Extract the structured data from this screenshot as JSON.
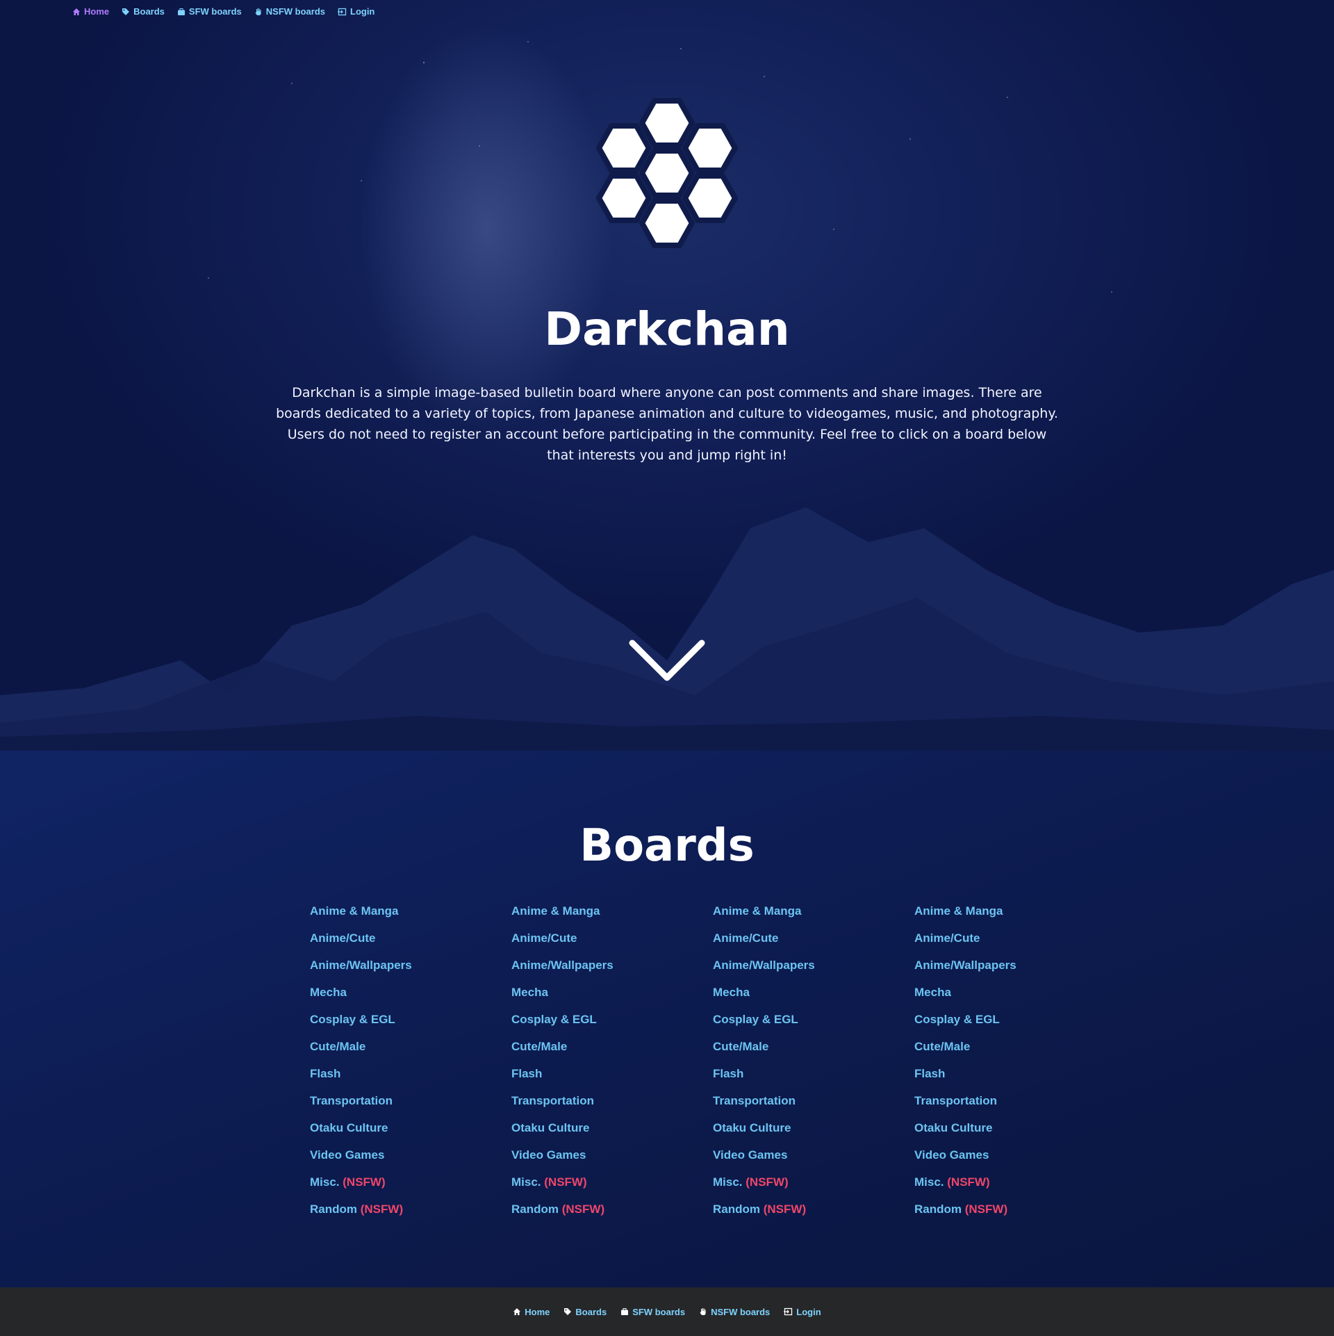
{
  "nav": {
    "items": [
      {
        "label": "Home",
        "icon": "home-icon",
        "active": true
      },
      {
        "label": "Boards",
        "icon": "tag-icon"
      },
      {
        "label": "SFW boards",
        "icon": "briefcase-icon"
      },
      {
        "label": "NSFW boards",
        "icon": "hand-icon"
      },
      {
        "label": "Login",
        "icon": "login-icon"
      }
    ]
  },
  "hero": {
    "title": "Darkchan",
    "intro": "Darkchan is a simple image-based bulletin board where anyone can post comments and share images. There are boards dedicated to a variety of topics, from Japanese animation and culture to videogames, music, and photography. Users do not need to register an account before participating in the community. Feel free to click on a board below that interests you and jump right in!"
  },
  "boards": {
    "title": "Boards",
    "nsfw_label": "(NSFW)",
    "columns": [
      [
        {
          "name": "Anime & Manga"
        },
        {
          "name": "Anime/Cute"
        },
        {
          "name": "Anime/Wallpapers"
        },
        {
          "name": "Mecha"
        },
        {
          "name": "Cosplay & EGL"
        },
        {
          "name": "Cute/Male"
        },
        {
          "name": "Flash"
        },
        {
          "name": "Transportation"
        },
        {
          "name": "Otaku Culture"
        },
        {
          "name": "Video Games"
        },
        {
          "name": "Misc.",
          "nsfw": true
        },
        {
          "name": "Random",
          "nsfw": true
        }
      ],
      [
        {
          "name": "Anime & Manga"
        },
        {
          "name": "Anime/Cute"
        },
        {
          "name": "Anime/Wallpapers"
        },
        {
          "name": "Mecha"
        },
        {
          "name": "Cosplay & EGL"
        },
        {
          "name": "Cute/Male"
        },
        {
          "name": "Flash"
        },
        {
          "name": "Transportation"
        },
        {
          "name": "Otaku Culture"
        },
        {
          "name": "Video Games"
        },
        {
          "name": "Misc.",
          "nsfw": true
        },
        {
          "name": "Random",
          "nsfw": true
        }
      ],
      [
        {
          "name": "Anime & Manga"
        },
        {
          "name": "Anime/Cute"
        },
        {
          "name": "Anime/Wallpapers"
        },
        {
          "name": "Mecha"
        },
        {
          "name": "Cosplay & EGL"
        },
        {
          "name": "Cute/Male"
        },
        {
          "name": "Flash"
        },
        {
          "name": "Transportation"
        },
        {
          "name": "Otaku Culture"
        },
        {
          "name": "Video Games"
        },
        {
          "name": "Misc.",
          "nsfw": true
        },
        {
          "name": "Random",
          "nsfw": true
        }
      ],
      [
        {
          "name": "Anime & Manga"
        },
        {
          "name": "Anime/Cute"
        },
        {
          "name": "Anime/Wallpapers"
        },
        {
          "name": "Mecha"
        },
        {
          "name": "Cosplay & EGL"
        },
        {
          "name": "Cute/Male"
        },
        {
          "name": "Flash"
        },
        {
          "name": "Transportation"
        },
        {
          "name": "Otaku Culture"
        },
        {
          "name": "Video Games"
        },
        {
          "name": "Misc.",
          "nsfw": true
        },
        {
          "name": "Random",
          "nsfw": true
        }
      ]
    ]
  },
  "colors": {
    "link": "#6cc4f2",
    "nav_link": "#7fd3ff",
    "nav_active": "#b07cff",
    "nsfw": "#f0466a",
    "footer_bg": "#262729"
  }
}
